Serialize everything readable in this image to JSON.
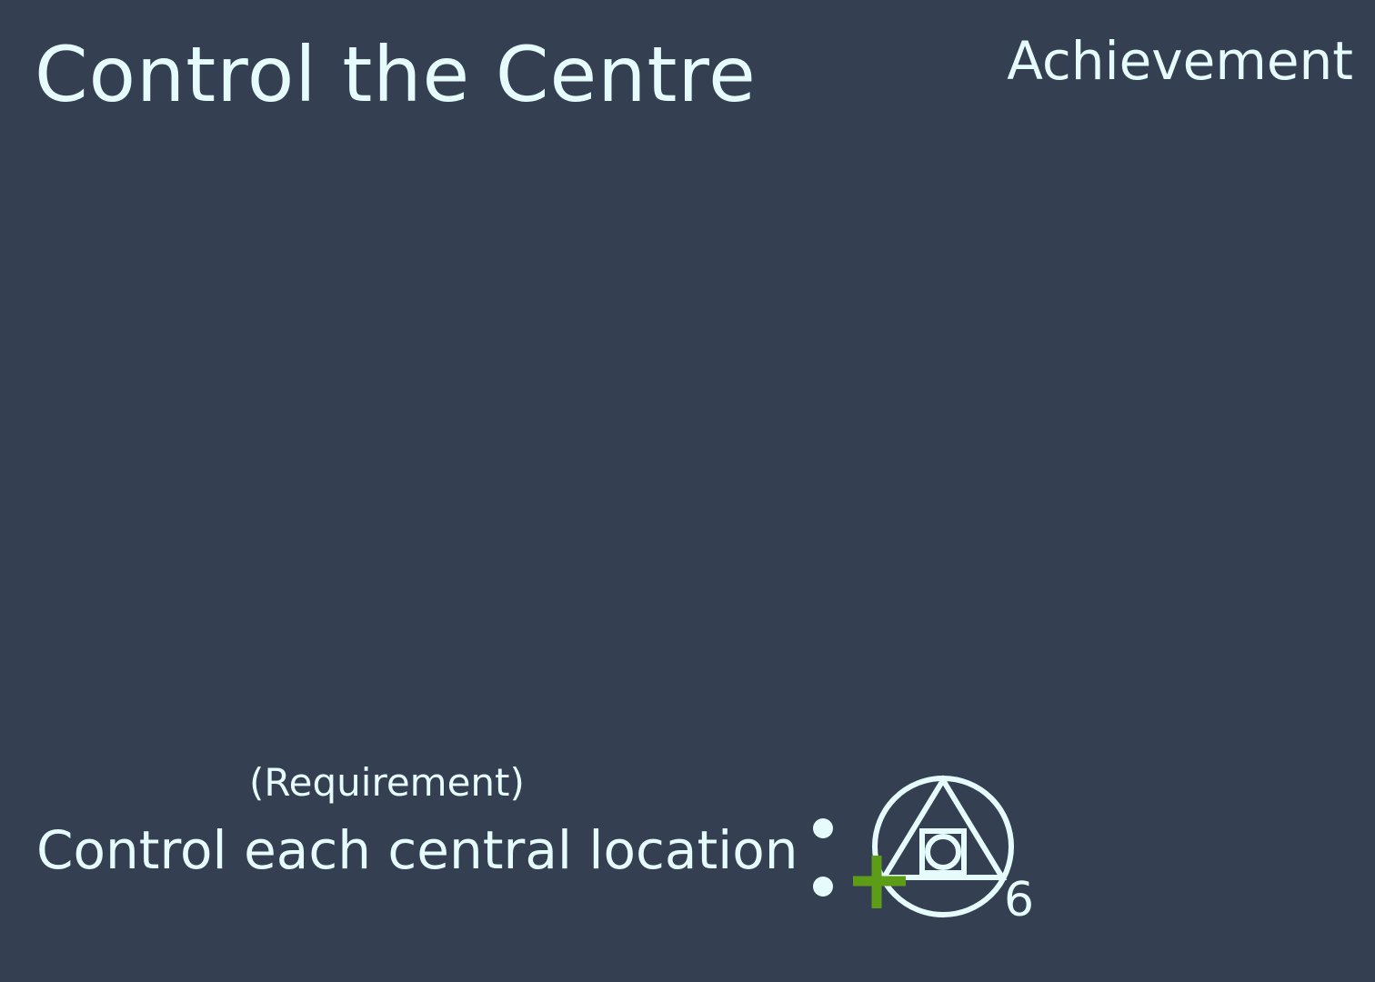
{
  "card": {
    "title": "Control the Centre",
    "type": "Achievement"
  },
  "requirement": {
    "tag": "(Requirement)",
    "text": "Control each central location"
  },
  "reward": {
    "icon": "philosophers-stone-icon",
    "modifier_icon": "plus-icon",
    "count": "6"
  },
  "colors": {
    "background": "#353f52",
    "text": "#e6fbfb",
    "plus": "#5c9c16"
  }
}
